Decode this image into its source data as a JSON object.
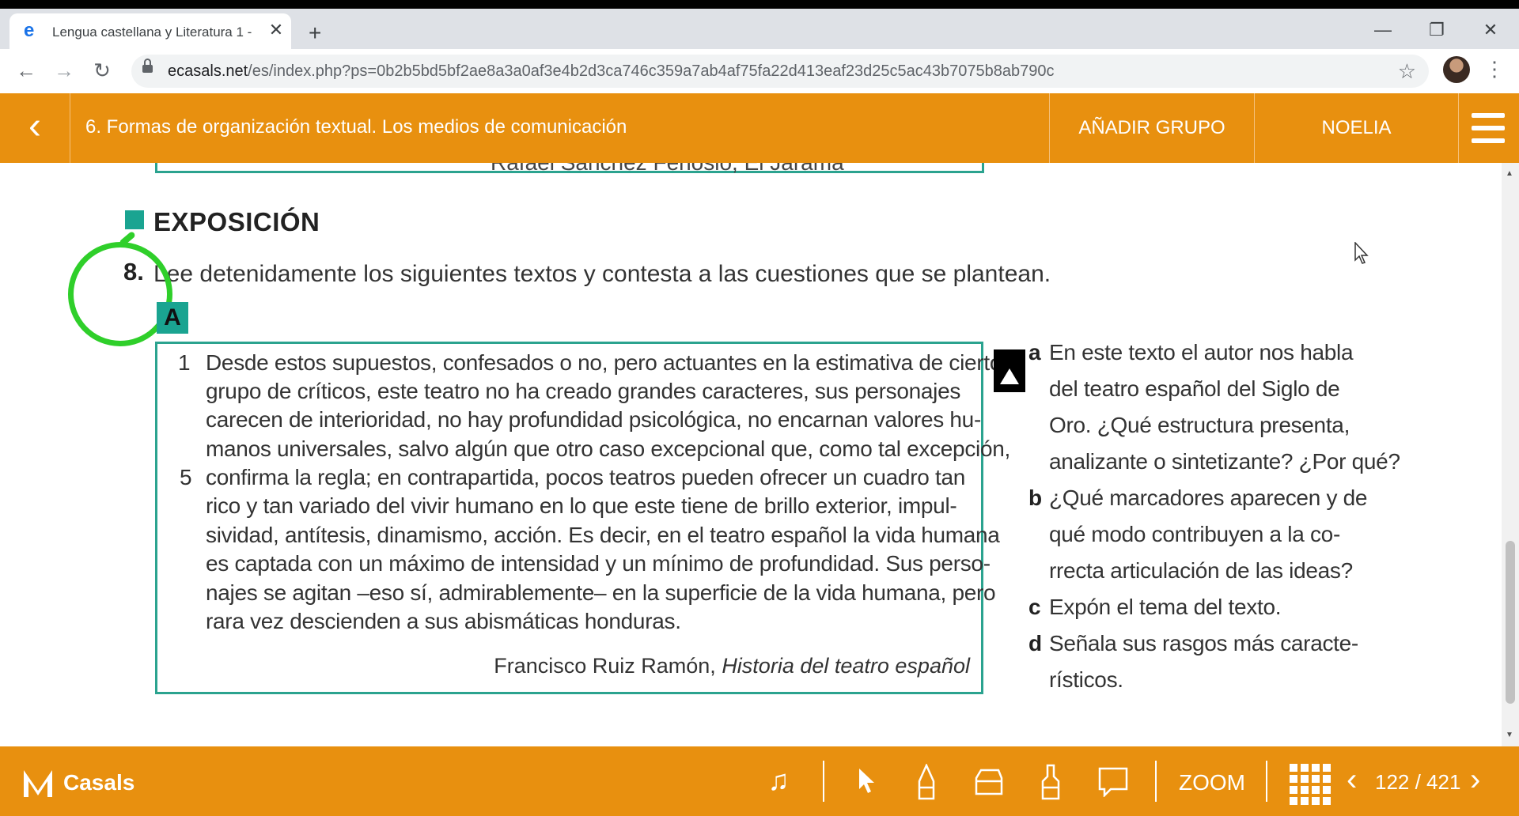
{
  "browser": {
    "tab_title": "Lengua castellana y Literatura 1 -",
    "tab_close": "✕",
    "new_tab": "+",
    "url_host": "ecasals.net",
    "url_path": "/es/index.php?ps=0b2b5bd5bf2ae8a3a0af3e4b2d3ca746c359a7ab4af75fa22d413eaf23d25c5ac43b7075b8ab790c",
    "minimize": "—",
    "restore": "❐",
    "close": "✕"
  },
  "app": {
    "back": "‹",
    "title": "6. Formas de organización textual. Los medios de comunicación",
    "add_group": "AÑADIR GRUPO",
    "user": "NOELIA"
  },
  "page": {
    "prev_citation_fragment": "Rafael Sánchez Ferlosio, El Jarama",
    "section_title": "EXPOSICIÓN",
    "question_number": "8.",
    "question_text": "Lee detenidamente los siguientes textos y contesta a las cuestiones que se plantean.",
    "text_label": "A",
    "line_numbers": [
      "1",
      "5"
    ],
    "paragraph_lines": [
      "Desde estos supuestos, confesados o no, pero actuantes en la estimativa de cierto",
      "grupo de críticos, este teatro no ha creado grandes caracteres, sus personajes",
      "carecen de interioridad, no hay profundidad psicológica, no encarnan valores hu-",
      "manos universales, salvo algún que otro caso excepcional que, como tal excepción,",
      "confirma la regla; en contrapartida, pocos teatros pueden ofrecer un cuadro tan",
      "rico y tan variado del vivir humano en lo que este tiene de brillo exterior, impul-",
      "sividad, antítesis, dinamismo, acción. Es decir, en el teatro español la vida humana",
      "es captada con un máximo de intensidad y un mínimo de profundidad. Sus perso-",
      "najes se agitan –eso sí, admirablemente– en la superficie de la vida humana, pero",
      "rara vez descienden a sus abismáticas honduras."
    ],
    "citation_author": "Francisco Ruiz Ramón, ",
    "citation_work": "Historia del teatro español",
    "questions": [
      {
        "letter": "a",
        "lines": [
          "En este texto el autor nos habla",
          "del teatro español del Siglo de",
          "Oro. ¿Qué estructura presenta,",
          "analizante o sintetizante? ¿Por qué?"
        ]
      },
      {
        "letter": "b",
        "lines": [
          "¿Qué marcadores aparecen y de",
          "qué modo contribuyen a la co-",
          "rrecta articulación de las ideas?"
        ]
      },
      {
        "letter": "c",
        "lines": [
          "Expón el tema del texto."
        ]
      },
      {
        "letter": "d",
        "lines": [
          "Señala sus rasgos más caracte-",
          "rísticos."
        ]
      }
    ]
  },
  "footer": {
    "brand": "Casals",
    "zoom": "ZOOM",
    "page_indicator": "122 / 421",
    "current_page": 122,
    "total_pages": 421
  },
  "colors": {
    "accent_orange": "#e8900f",
    "teal": "#1aa491",
    "annotation_green": "#2fcf2a"
  },
  "icons": [
    "music-icon",
    "pointer-icon",
    "pen-icon",
    "eraser-icon",
    "highlighter-icon",
    "comment-icon",
    "grid-icon",
    "chevron-left-icon",
    "chevron-right-icon"
  ]
}
